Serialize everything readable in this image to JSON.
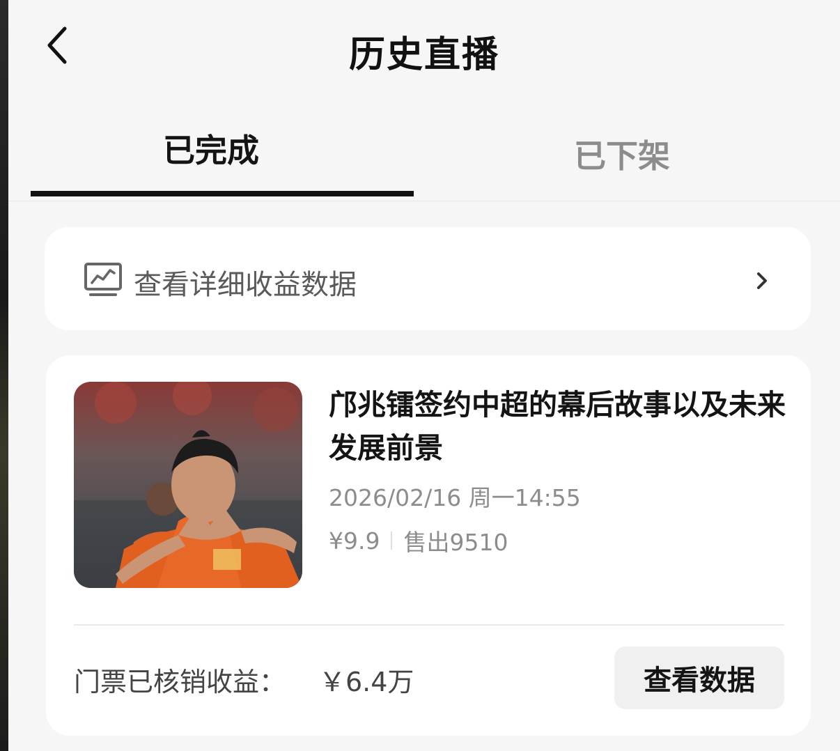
{
  "header": {
    "title": "历史直播",
    "back_icon": "chevron-left-icon"
  },
  "tabs": [
    {
      "label": "已完成",
      "active": true
    },
    {
      "label": "已下架",
      "active": false
    }
  ],
  "income_entry": {
    "label": "查看详细收益数据",
    "icon": "chart-monitor-icon",
    "chevron_icon": "chevron-right-icon"
  },
  "live_item": {
    "title": "邝兆镭签约中超的幕后故事以及未来发展前景",
    "datetime": "2026/02/16 周一14:55",
    "price": "¥9.9",
    "sold": "售出9510",
    "revenue_label": "门票已核销收益：",
    "revenue_value": "￥6.4万",
    "view_data_label": "查看数据"
  },
  "colors": {
    "background": "#f6f6f6",
    "card": "#ffffff",
    "primary_text": "#141414",
    "secondary_text": "#8c8c8c",
    "tab_indicator": "#111111",
    "button_bg": "#f0f0f0"
  }
}
